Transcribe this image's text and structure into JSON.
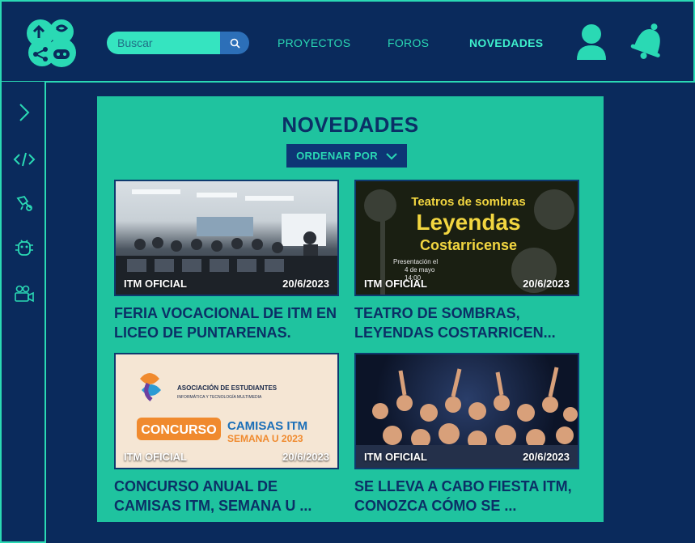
{
  "header": {
    "search_placeholder": "Buscar",
    "nav": [
      {
        "label": "PROYECTOS"
      },
      {
        "label": "FOROS"
      },
      {
        "label": "NOVEDADES",
        "active": true
      }
    ]
  },
  "sidebar": {
    "items": [
      {
        "icon": "chevron-right-icon"
      },
      {
        "icon": "code-icon"
      },
      {
        "icon": "gamepad-icon"
      },
      {
        "icon": "bug-icon"
      },
      {
        "icon": "camera-icon"
      }
    ]
  },
  "main": {
    "title": "NOVEDADES",
    "sort_label": "ORDENAR POR",
    "cards": [
      {
        "source": "ITM OFICIAL",
        "date": "20/6/2023",
        "title": "FERIA VOCACIONAL DE ITM EN LICEO DE PUNTARENAS."
      },
      {
        "source": "ITM OFICIAL",
        "date": "20/6/2023",
        "title": "TEATRO DE SOMBRAS, LEYENDAS COSTARRICEN...",
        "image_text": {
          "line1": "Teatros de sombras",
          "line2": "Leyendas",
          "line3": "Costarricense",
          "detail1": "Presentación el",
          "detail2": "4 de mayo",
          "detail3": "14:00"
        }
      },
      {
        "source": "ITM OFICIAL",
        "date": "20/6/2023",
        "title": "CONCURSO ANUAL DE CAMISAS ITM, SEMANA U ...",
        "image_text": {
          "assoc1": "ASOCIACIÓN DE ESTUDIANTES",
          "assoc2": "INFORMÁTICA Y TECNOLOGÍA MULTIMEDIA",
          "badge": "CONCURSO",
          "line1": "CAMISAS ITM",
          "line2": "SEMANA U 2023"
        }
      },
      {
        "source": "ITM OFICIAL",
        "date": "20/6/2023",
        "title": "SE LLEVA A CABO FIESTA ITM, CONOZCA CÓMO SE ..."
      }
    ]
  },
  "colors": {
    "background": "#0a2a5c",
    "accent": "#2ad9b4",
    "panel": "#1fc39f",
    "title": "#0b2f66"
  }
}
